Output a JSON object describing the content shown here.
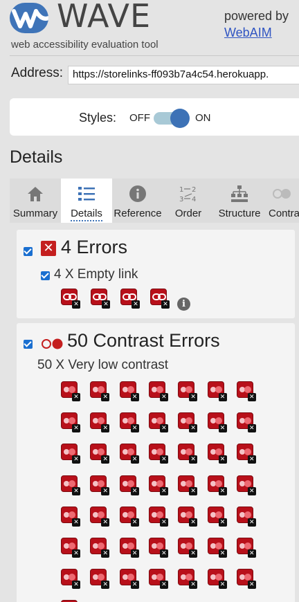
{
  "header": {
    "wordmark": "WAVE",
    "tagline": "web accessibility evaluation tool",
    "powered_by": "powered by",
    "webaim_link": "WebAIM"
  },
  "address": {
    "label": "Address:",
    "value": "https://storelinks-ff093b7a4c54.herokuapp."
  },
  "styles": {
    "label": "Styles:",
    "off": "OFF",
    "on": "ON",
    "state": "on"
  },
  "details_heading": "Details",
  "tabs": [
    {
      "label": "Summary",
      "icon": "home-icon",
      "active": false
    },
    {
      "label": "Details",
      "icon": "list-icon",
      "active": true
    },
    {
      "label": "Reference",
      "icon": "info-icon",
      "active": false
    },
    {
      "label": "Order",
      "icon": "order-icon",
      "active": false
    },
    {
      "label": "Structure",
      "icon": "structure-icon",
      "active": false
    },
    {
      "label": "Contra",
      "icon": "contrast-icon",
      "active": false
    }
  ],
  "errors_section": {
    "title": "4 Errors",
    "item_label": "4 X Empty link",
    "count": 4
  },
  "contrast_section": {
    "title": "50 Contrast Errors",
    "item_label": "50 X Very low contrast",
    "count": 50
  },
  "colors": {
    "accent": "#3d72b6",
    "error": "#c41f1f",
    "contrast_error": "#b8101a",
    "link": "#2f54c2"
  }
}
